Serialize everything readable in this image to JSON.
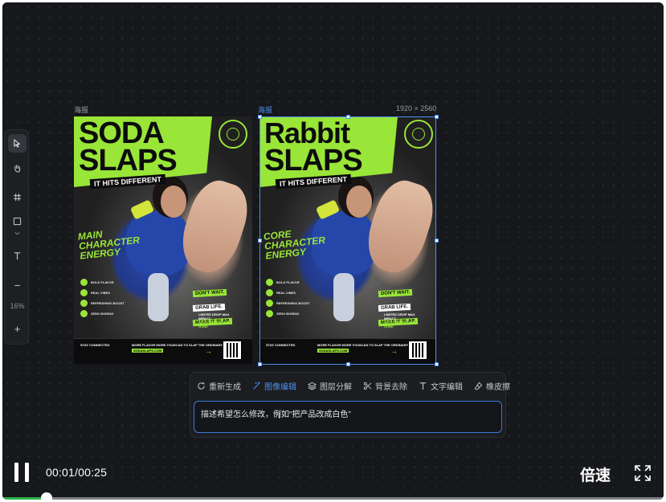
{
  "toolbar": {
    "tools": [
      {
        "name": "select",
        "icon": "cursor-arrow-icon"
      },
      {
        "name": "hand",
        "icon": "hand-icon"
      },
      {
        "name": "frame",
        "icon": "hash-frame-icon"
      },
      {
        "name": "shape",
        "icon": "square-icon"
      },
      {
        "name": "text",
        "icon": "text-icon"
      }
    ],
    "zoom_out": "−",
    "zoom_level": "16%",
    "zoom_in": "+"
  },
  "canvas": {
    "posters": [
      {
        "label": "海报",
        "title_line1": "SODA",
        "title_line2": "SLAPS"
      },
      {
        "label": "海报",
        "size": "1920 × 2560",
        "title_line1": "Rabbit",
        "title_line2": "SLAPS"
      }
    ],
    "poster_common": {
      "tagline": "IT HITS DIFFERENT",
      "main_character": "MAIN CHARACTER ENERGY",
      "core_character": "CORE CHARACTER ENERGY",
      "features": [
        "BOLD FLAVOR",
        "REAL VIBES",
        "REFRESHING BOOST",
        "ZERO BORING"
      ],
      "stickers": [
        "DON'T WAIT.",
        "GRAB LIFE.",
        "MAKE IT SLAP."
      ],
      "limited": "LIMITED DROP MAX IMPACT",
      "limited_cta": "GET IT BEFORE IT'S GONE",
      "footer_stay": "STAY CONNECTED",
      "footer_flavor": "MORE FLAVOR MORE YOU",
      "footer_url": "SODASLAPS.COM",
      "footer_scan": "SCAN TO SLAP THE ORDINARY"
    }
  },
  "actions": [
    {
      "label": "重新生成",
      "icon": "refresh-icon",
      "active": false
    },
    {
      "label": "图像编辑",
      "icon": "magic-wand-icon",
      "active": true
    },
    {
      "label": "图层分解",
      "icon": "layers-icon",
      "active": false
    },
    {
      "label": "背景去除",
      "icon": "scissors-icon",
      "active": false
    },
    {
      "label": "文字编辑",
      "icon": "text-icon",
      "active": false
    },
    {
      "label": "橡皮擦",
      "icon": "eraser-icon",
      "active": false
    }
  ],
  "prompt": {
    "placeholder": "描述希望怎么修改，例如“把产品改成白色”"
  },
  "player": {
    "time": "00:01/00:25",
    "progress": 0.04,
    "speed_label": "倍速"
  },
  "colors": {
    "accent": "#4e8ff2",
    "brand_green": "#99e538",
    "progress": "#2bb24c"
  }
}
